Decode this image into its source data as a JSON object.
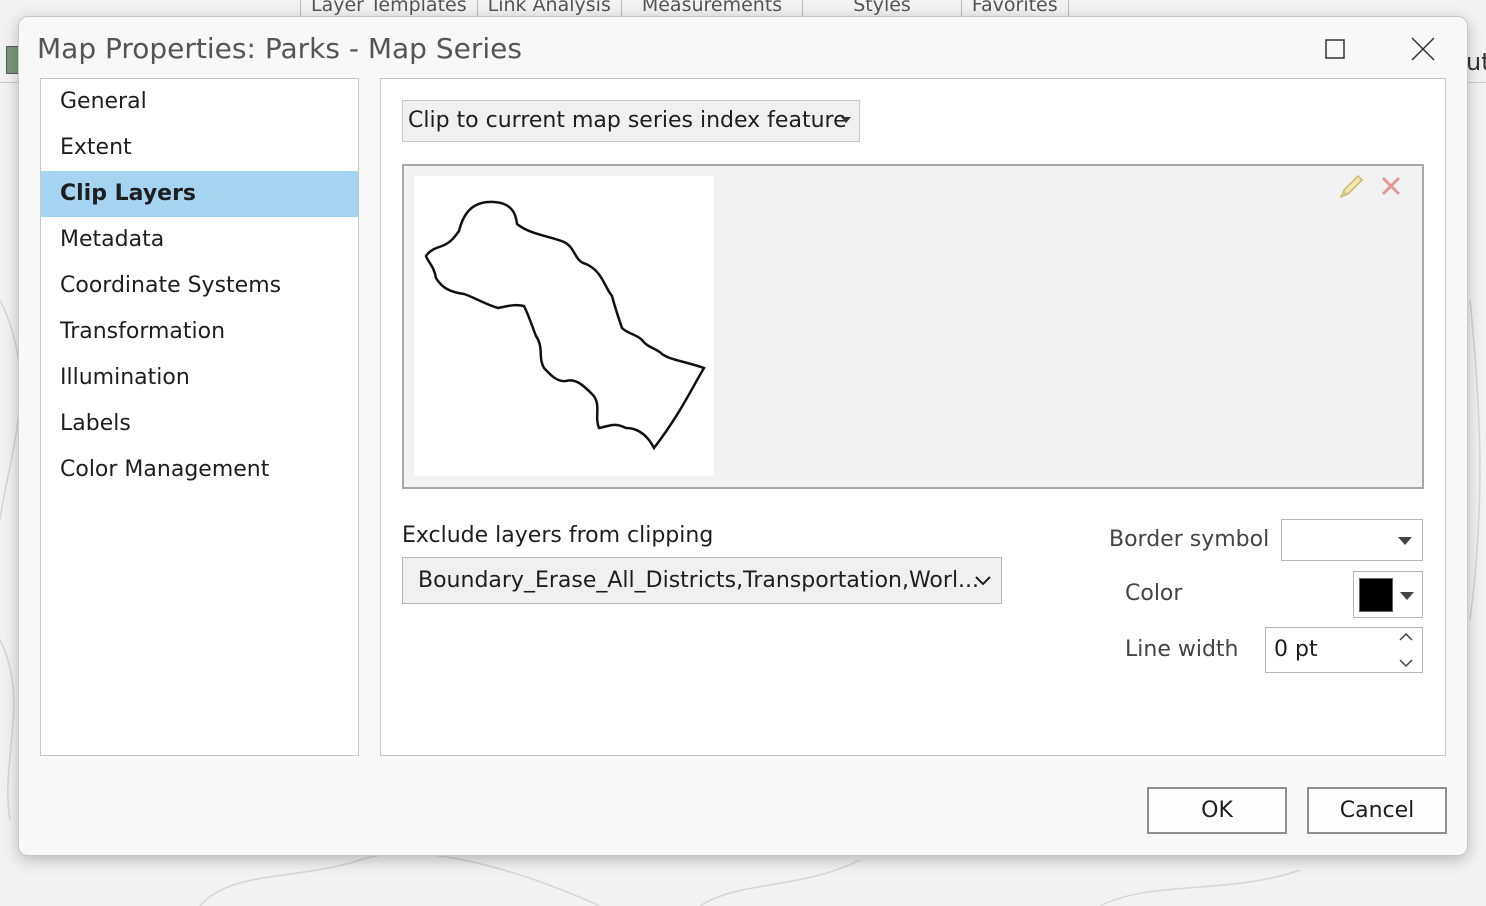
{
  "background": {
    "ribbon_tabs": [
      "Layer Templates",
      "Link Analysis",
      "Measurements",
      "Styles",
      "Favorites"
    ],
    "edge_text": "ut"
  },
  "dialog": {
    "title": "Map Properties: Parks - Map Series",
    "nav": {
      "items": [
        {
          "label": "General"
        },
        {
          "label": "Extent"
        },
        {
          "label": "Clip Layers"
        },
        {
          "label": "Metadata"
        },
        {
          "label": "Coordinate Systems"
        },
        {
          "label": "Transformation"
        },
        {
          "label": "Illumination"
        },
        {
          "label": "Labels"
        },
        {
          "label": "Color Management"
        }
      ],
      "selected": "Clip Layers"
    },
    "clip": {
      "mode": "Clip to current map series index feature",
      "exclude_label": "Exclude layers from clipping",
      "exclude_value": "Boundary_Erase_All_Districts,Transportation,Worl...",
      "border_symbol_label": "Border symbol",
      "color_label": "Color",
      "color": "#000000",
      "line_width_label": "Line width",
      "line_width_value": "0 pt"
    },
    "buttons": {
      "ok": "OK",
      "cancel": "Cancel"
    }
  }
}
